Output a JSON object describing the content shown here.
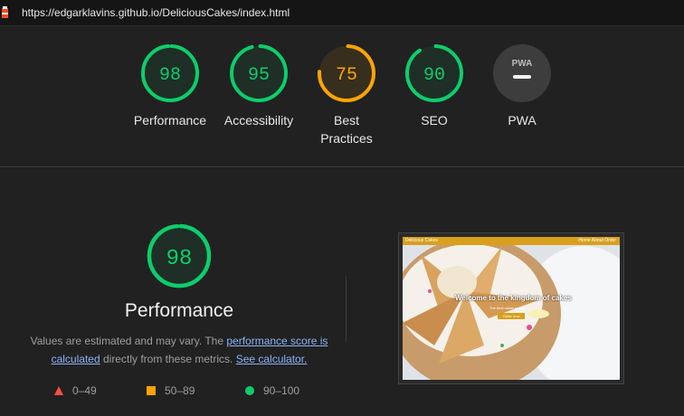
{
  "topbar": {
    "url": "https://edgarklavins.github.io/DeliciousCakes/index.html"
  },
  "gauges": [
    {
      "score": "98",
      "label": "Performance",
      "fraction": 0.98,
      "color": "#0cce6b"
    },
    {
      "score": "95",
      "label": "Accessibility",
      "fraction": 0.95,
      "color": "#0cce6b"
    },
    {
      "score": "75",
      "label": "Best Practices",
      "fraction": 0.75,
      "color": "#ffa400"
    },
    {
      "score": "90",
      "label": "SEO",
      "fraction": 0.9,
      "color": "#0cce6b"
    },
    {
      "score": "PWA",
      "label": "PWA"
    }
  ],
  "performance": {
    "score": "98",
    "fraction": 0.98,
    "title": "Performance",
    "desc_start": "Values are estimated and may vary. The ",
    "link1": "performance score is calculated",
    "desc_mid": " directly from these metrics. ",
    "link2": "See calculator."
  },
  "legend": [
    {
      "range": "0–49",
      "color": "#ff4e42",
      "shape": "triangle"
    },
    {
      "range": "50–89",
      "color": "#ffa400",
      "shape": "square"
    },
    {
      "range": "90–100",
      "color": "#0cce6b",
      "shape": "circle"
    }
  ],
  "screenshot": {
    "site_brand": "Delicious Cakes",
    "site_links": "Home About Order",
    "hero_title": "Welcome to the kingdom of cakes",
    "hero_sub": "The best cakes in town",
    "hero_button": "Order now"
  },
  "colors": {
    "pass": "#0cce6b",
    "average": "#ffa400",
    "fail": "#ff4e42",
    "background": "#212121"
  }
}
